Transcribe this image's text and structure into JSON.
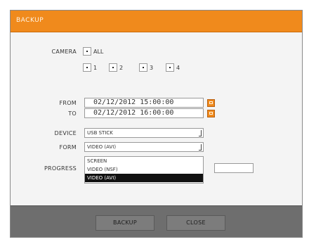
{
  "window": {
    "title": "BACKUP"
  },
  "camera": {
    "label": "CAMERA",
    "all_label": "ALL",
    "channels": [
      "1",
      "2",
      "3",
      "4"
    ]
  },
  "time": {
    "from_label": "FROM",
    "from_value": "02/12/2012 15:00:00",
    "to_label": "TO",
    "to_value": "02/12/2012 16:00:00"
  },
  "device": {
    "label": "DEVICE",
    "value": "USB STICK"
  },
  "form": {
    "label": "FORM",
    "value": "VIDEO (AVI)",
    "options": [
      "SCREEN",
      "VIDEO (NSF)",
      "VIDEO (AVI)"
    ],
    "selected_index": 2
  },
  "progress": {
    "label": "PROGRESS"
  },
  "buttons": {
    "backup": "BACKUP",
    "close": "CLOSE"
  },
  "colors": {
    "accent": "#f08a1c",
    "footer": "#6e6e6e"
  }
}
